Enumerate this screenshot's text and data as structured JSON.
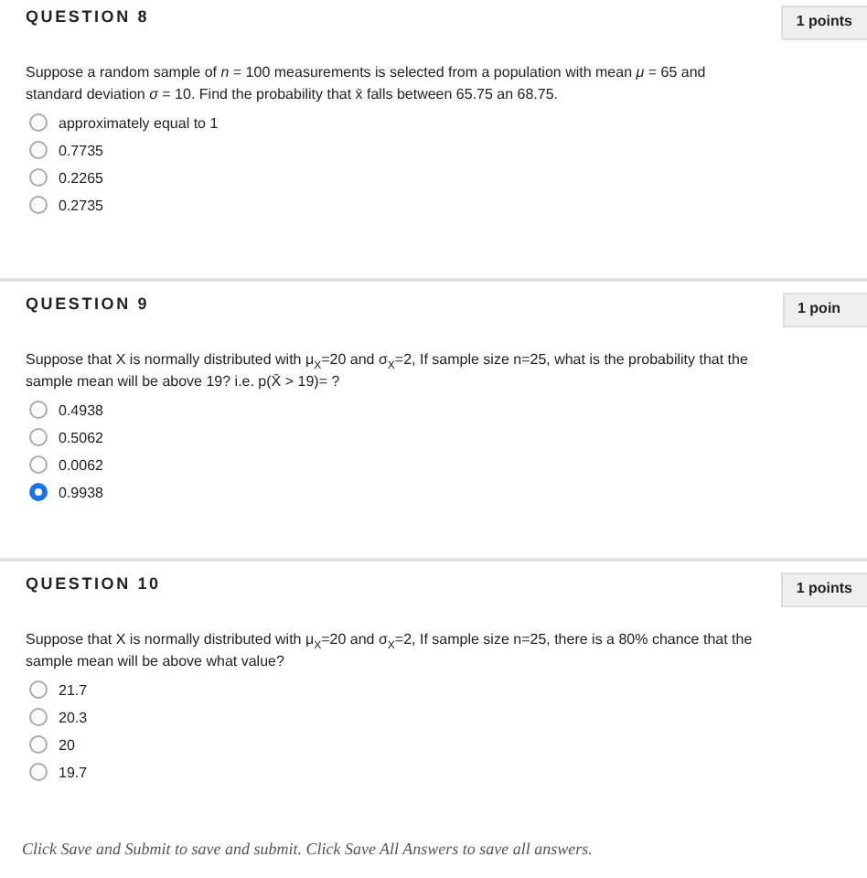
{
  "questions": [
    {
      "title": "QUESTION 8",
      "points": "1 points",
      "text": "Suppose a random sample of *n* = 100 measurements is selected from a population with mean *μ* = 65 and standard deviation *σ* = 10. Find the probability that x̄  falls between 65.75 an 68.75.",
      "options": [
        {
          "label": "approximately equal to 1",
          "selected": false
        },
        {
          "label": "0.7735",
          "selected": false
        },
        {
          "label": "0.2265",
          "selected": false
        },
        {
          "label": "0.2735",
          "selected": false
        }
      ]
    },
    {
      "title": "QUESTION 9",
      "points": "1 poin",
      "text": "Suppose that X is normally distributed with μ$_{X}$=20 and σ$_{X}$=2, If sample size n=25, what is the probability that the sample mean will be above 19? i.e. p(X̄ > 19)= ?",
      "options": [
        {
          "label": "0.4938",
          "selected": false
        },
        {
          "label": "0.5062",
          "selected": false
        },
        {
          "label": "0.0062",
          "selected": false
        },
        {
          "label": "0.9938",
          "selected": true
        }
      ]
    },
    {
      "title": "QUESTION 10",
      "points": "1 points",
      "text": "Suppose that X is normally distributed with μ$_{X}$=20 and σ$_{X}$=2, If sample size n=25, there is a 80% chance that the sample mean will be above what value?",
      "options": [
        {
          "label": "21.7",
          "selected": false
        },
        {
          "label": "20.3",
          "selected": false
        },
        {
          "label": "20",
          "selected": false
        },
        {
          "label": "19.7",
          "selected": false
        }
      ]
    }
  ],
  "footer": "Click Save and Submit to save and submit. Click Save All Answers to save all answers."
}
